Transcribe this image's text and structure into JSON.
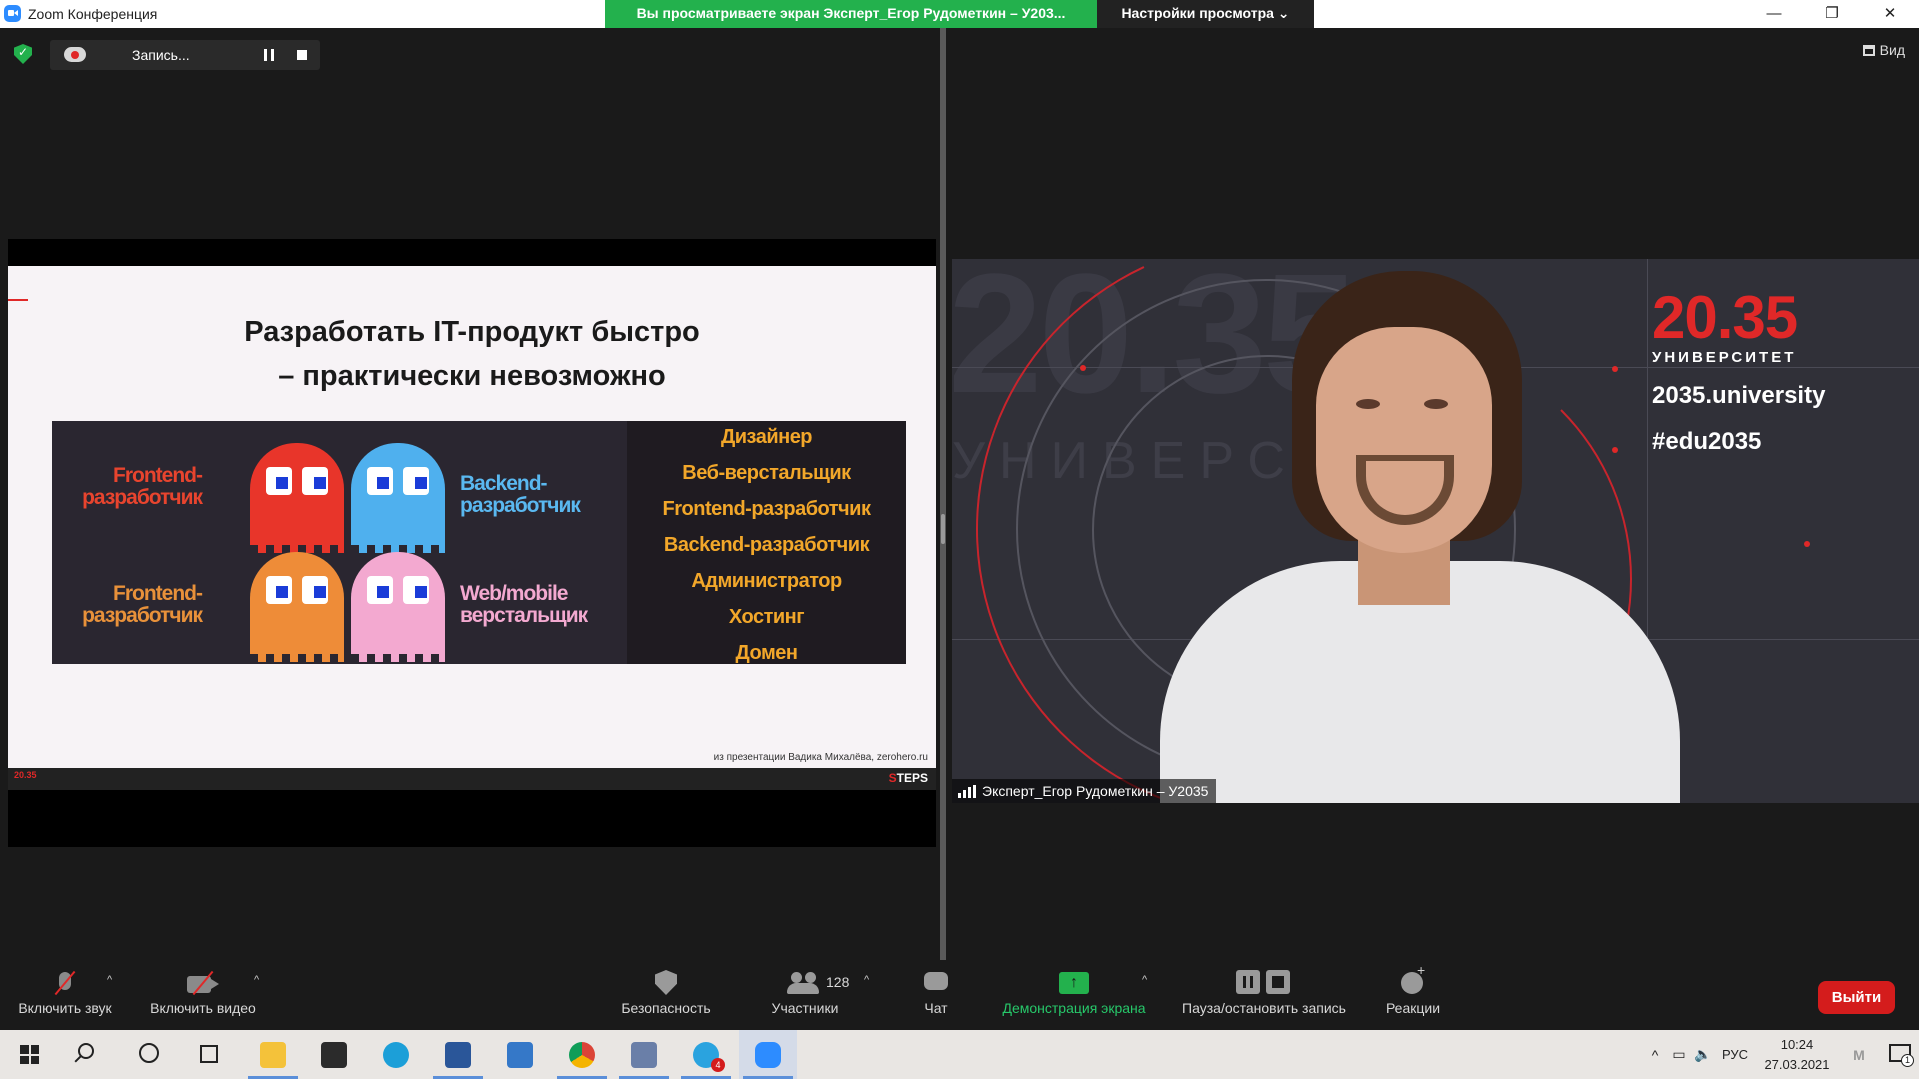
{
  "window": {
    "app_title": "Zoom Конференция",
    "share_banner": "Вы просматриваете экран Эксперт_Егор Рудометкин – У203...",
    "view_settings": "Настройки просмотра ⌄",
    "controls": [
      "—",
      "❐",
      "✕"
    ]
  },
  "recording": {
    "label": "Запись..."
  },
  "view_button": {
    "label": "Вид"
  },
  "slide": {
    "title_line1": "Разработать IT-продукт быстро",
    "title_line2": "– практически невозможно",
    "roles_left": [
      {
        "label": "Frontend-\nразработчик",
        "ghost_color": "#e8352a"
      },
      {
        "label": "Backend-\nразработчик",
        "ghost_color": "#4fb0ee"
      },
      {
        "label": "Frontend-\nразработчик",
        "ghost_color": "#ee8c38"
      },
      {
        "label": "Web/mobile\nверстальщик",
        "ghost_color": "#f3a9d0"
      }
    ],
    "roles_list": [
      "Дизайнер",
      "Веб-верстальщик",
      "Frontend-разработчик",
      "Backend-разработчик",
      "Администратор",
      "Хостинг",
      "Домен"
    ],
    "source": "из презентации Вадика Михалёва, zerohero.ru",
    "footer_logo": "20.35",
    "footer_steps_s": "S",
    "footer_steps_rest": "TEPS"
  },
  "speaker": {
    "name": "Эксперт_Егор Рудометкин – У2035",
    "brand_number": "20.35",
    "brand_university": "УНИВЕРСИТЕТ",
    "brand_site": "2035.university",
    "brand_tag": "#edu2035",
    "bg_number": "20.35",
    "bg_word": "УНИВЕРСИТЕ"
  },
  "toolbar": {
    "unmute": "Включить звук",
    "start_video": "Включить видео",
    "security": "Безопасность",
    "participants": "Участники",
    "participants_count": "128",
    "chat": "Чат",
    "share_screen": "Демонстрация экрана",
    "pause_stop": "Пауза/остановить запись",
    "reactions": "Реакции",
    "leave": "Выйти",
    "colors": {
      "green": "#27c86a",
      "leave": "#d41c1c"
    }
  },
  "taskbar": {
    "apps": [
      "start-icon",
      "search-icon",
      "cortana-icon",
      "task-view-icon",
      "file-explorer-icon",
      "store-icon",
      "edge-icon",
      "word-icon",
      "mail-icon",
      "chrome-icon",
      "snipping-icon",
      "telegram-icon",
      "zoom-icon"
    ],
    "telegram_badge": "4",
    "language": "РУС",
    "time": "10:24",
    "date": "27.03.2021",
    "notifications": "1"
  }
}
